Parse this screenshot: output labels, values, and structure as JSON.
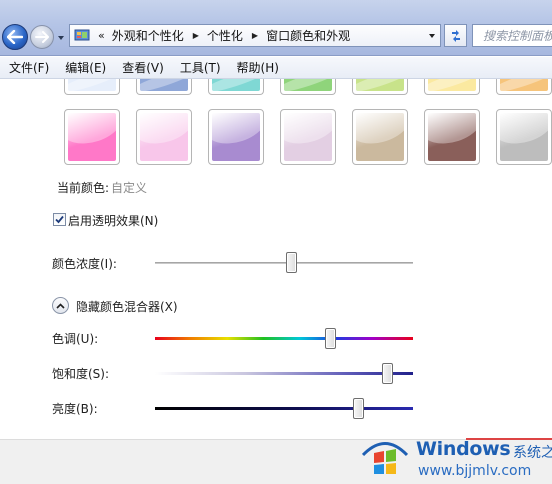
{
  "address_bar": {
    "lead": "«",
    "crumbs": [
      "外观和个性化",
      "个性化",
      "窗口颜色和外观"
    ],
    "search_placeholder": "搜索控制面板"
  },
  "menu": [
    "文件(F)",
    "编辑(E)",
    "查看(V)",
    "工具(T)",
    "帮助(H)"
  ],
  "swatches": {
    "top_row": [
      "#e6eefb",
      "#8fa7d8",
      "#7fd8d4",
      "#8fd47b",
      "#c8e38a",
      "#fbe9a0",
      "#f6c47b"
    ],
    "bottom_row": [
      "#ff78c8",
      "#f8c6ea",
      "#a88bd0",
      "#e3cfe3",
      "#cbb99e",
      "#8a5f5a",
      "#bdbdbd"
    ]
  },
  "current_color_label": "当前颜色:",
  "current_color_value": "自定义",
  "transparency": {
    "label": "启用透明效果(N)",
    "checked": true
  },
  "intensity": {
    "label": "颜色浓度(I):",
    "value": 0.53
  },
  "mixer_toggle_label": "隐藏颜色混合器(X)",
  "mixer": [
    {
      "label": "色调(U):",
      "value": 0.68,
      "gradient": "linear-gradient(90deg,#e8001c 0%,#f07f00 14%,#e8e000 28%,#20c020 42%,#00c8d8 56%,#1d3ce0 70%,#a000c8 84%,#e8001c 100%)"
    },
    {
      "label": "饱和度(S):",
      "value": 0.9,
      "gradient": "linear-gradient(90deg,#ffffff 0%,#c9c6df 35%,#5d5ab8 75%,#20208a 100%)"
    },
    {
      "label": "亮度(B):",
      "value": 0.79,
      "gradient": "linear-gradient(90deg,#000000 0%,#0e0e50 55%,#2a2ab0 100%)"
    }
  ],
  "watermark": {
    "brand": "Windows",
    "brand_cn": "系统之家",
    "url": "www.bjjmlv.com"
  },
  "colors": {
    "title_gradient_top": "#c7d3ec",
    "accent_blue": "#1e5fb3"
  }
}
